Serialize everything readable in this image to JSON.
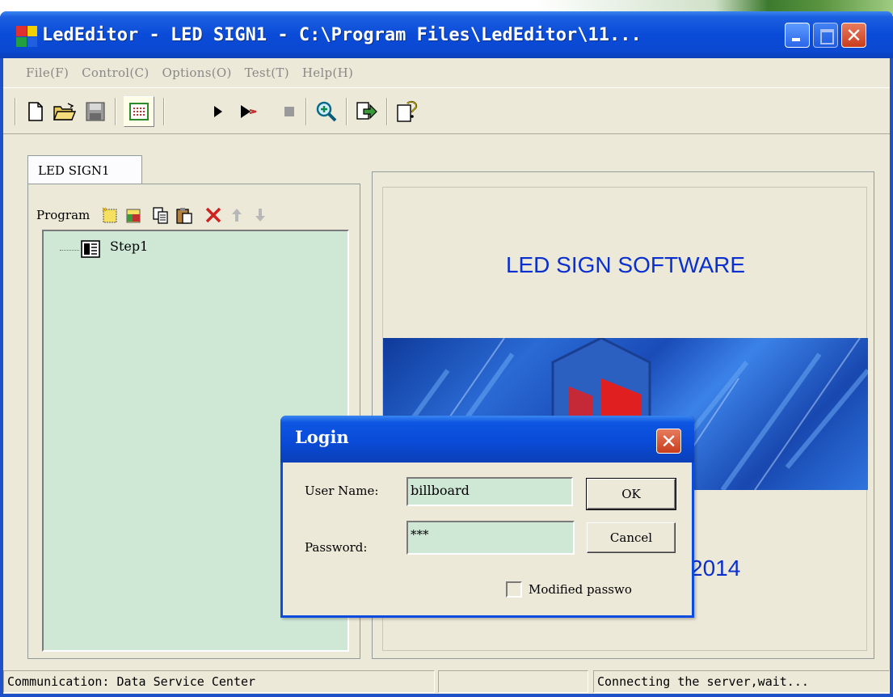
{
  "window": {
    "title": "LedEditor - LED SIGN1 - C:\\Program Files\\LedEditor\\11...",
    "close_glyph": "✕"
  },
  "menu": [
    "File(F)",
    "Control(C)",
    "Options(O)",
    "Test(T)",
    "Help(H)"
  ],
  "toolbar": {
    "icons": [
      "new-file-icon",
      "open-folder-icon",
      "save-icon",
      "grid-icon",
      "play-icon",
      "step-play-icon",
      "stop-icon",
      "zoom-icon",
      "export-icon",
      "help-icon"
    ]
  },
  "left": {
    "tab_label": "LED SIGN1",
    "program_label": "Program",
    "tree_item": "Step1"
  },
  "right": {
    "title": "LED SIGN SOFTWARE",
    "year_fragment": "2014"
  },
  "status": {
    "left": "Communication: Data Service Center",
    "middle": "",
    "right": "Connecting the server,wait..."
  },
  "login": {
    "title": "Login",
    "close_glyph": "✕",
    "username_label": "User Name:",
    "username_value": "billboard",
    "password_label": "Password:",
    "password_value": "***",
    "ok_label": "OK",
    "cancel_label": "Cancel",
    "checkbox_label": "Modified passwo"
  },
  "colors": {
    "title_bar": "#0a4bd8",
    "tree_bg": "#cfe8d6",
    "accent_text": "#0a2fd0"
  }
}
